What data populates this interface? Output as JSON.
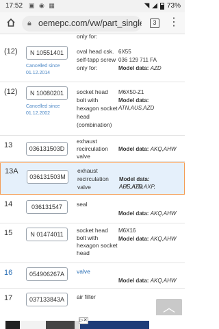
{
  "status": {
    "time": "17:52",
    "battery": "73%"
  },
  "browser": {
    "url": "oemepc.com/vw/part_single/c",
    "tab_count": "3"
  },
  "top_fragment": "only for:",
  "rows": [
    {
      "pos": "(12)",
      "part": "N 10551401",
      "cancelled": [
        "Cancelled since",
        "01.12.2014"
      ],
      "desc": [
        "oval head csk.",
        "self-tapp screw",
        "only for:"
      ],
      "info": {
        "code": "6X55",
        "extra": "036 129 711 FA",
        "model_label": "Model data:",
        "model_value": "AZD"
      }
    },
    {
      "pos": "(12)",
      "part": "N 10080201",
      "cancelled": [
        "Cancelled since",
        "01.12.2002"
      ],
      "desc": [
        "socket head",
        "bolt with",
        "hexagon socket",
        "head",
        "(combination)"
      ],
      "info": {
        "code": "M6X50-Z1",
        "model_label": "Model data:",
        "model_value": "ATN,AUS,AZD"
      }
    },
    {
      "pos": "13",
      "part": "036131503D",
      "desc": [
        "exhaust",
        "recirculation",
        "valve"
      ],
      "info": {
        "model_label": "Model data:",
        "model_value": "AKQ,AHW"
      }
    },
    {
      "pos": "13A",
      "part": "036131503M",
      "desc": [
        "exhaust",
        "recirculation",
        "valve"
      ],
      "info": {
        "model_label": "Model data:",
        "model_value": "APE,ATN,AXP,",
        "model_value2": "AUS,AZD"
      }
    },
    {
      "pos": "14",
      "part": "036131547",
      "desc": [
        "seal"
      ],
      "info": {
        "model_label": "Model data:",
        "model_value": "AKQ,AHW"
      }
    },
    {
      "pos": "15",
      "part": "N 01474011",
      "desc": [
        "socket head",
        "bolt with",
        "hexagon socket",
        "head"
      ],
      "info": {
        "code": "M6X16",
        "model_label": "Model data:",
        "model_value": "AKQ,AHW"
      }
    },
    {
      "pos": "16",
      "part": "054906267A",
      "desc": [
        "valve"
      ],
      "info": {
        "model_label": "Model data:",
        "model_value": "AKQ,AHW"
      }
    },
    {
      "pos": "17",
      "part": "037133843A",
      "desc": [
        "air filter"
      ]
    }
  ]
}
